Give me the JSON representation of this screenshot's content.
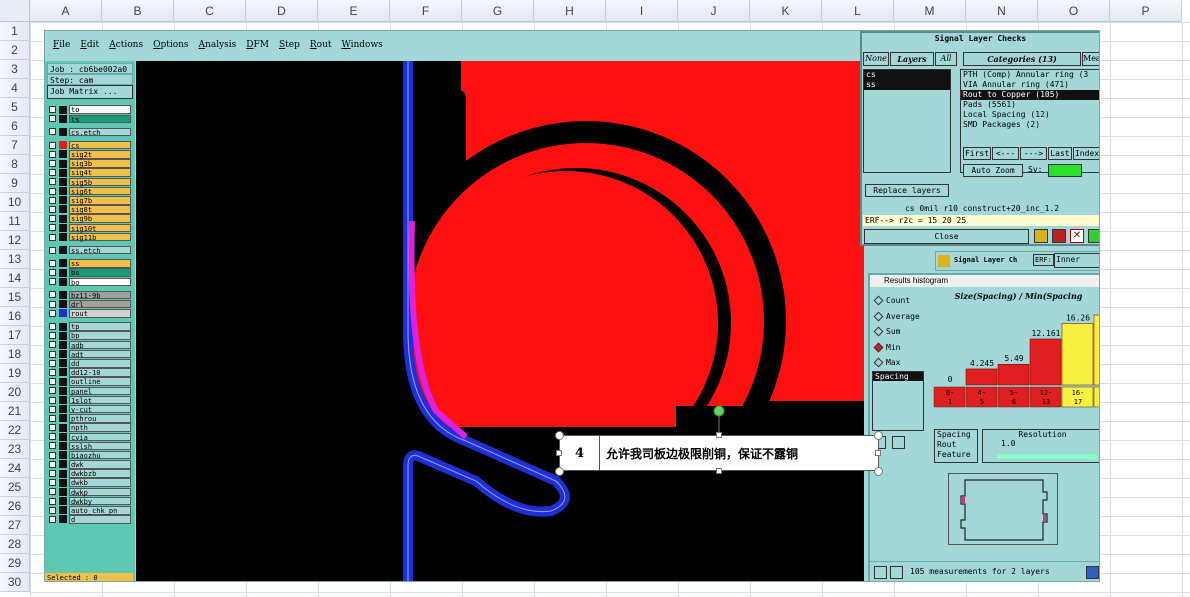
{
  "excel": {
    "columns": [
      "A",
      "B",
      "C",
      "D",
      "E",
      "F",
      "G",
      "H",
      "I",
      "J",
      "K",
      "L",
      "M",
      "N",
      "O",
      "P"
    ],
    "rows": [
      "1",
      "2",
      "3",
      "4",
      "5",
      "6",
      "7",
      "8",
      "9",
      "10",
      "11",
      "12",
      "13",
      "14",
      "15",
      "16",
      "17",
      "18",
      "19",
      "20",
      "21",
      "22",
      "23",
      "24",
      "25",
      "26",
      "27",
      "28",
      "29",
      "30"
    ]
  },
  "menu": [
    "File",
    "Edit",
    "Actions",
    "Options",
    "Analysis",
    "DFM",
    "Step",
    "Rout",
    "Windows"
  ],
  "left_panel": {
    "job": "Job : cb6be002a0",
    "step": "Step: cam",
    "job_matrix": "Job Matrix ...",
    "selected": "Selected : 0",
    "layers": [
      {
        "name": "to",
        "color": "#ffffff",
        "swatch": "#111111"
      },
      {
        "name": "ts",
        "color": "#1a9a7a",
        "swatch": "#111111"
      },
      {
        "gap": true
      },
      {
        "name": "cs.etch",
        "color": "#a4d7d8",
        "swatch": "#111111"
      },
      {
        "gap": true
      },
      {
        "name": "cs",
        "color": "#f0c04a",
        "swatch": "#e02020"
      },
      {
        "name": "sig2t",
        "color": "#f0c04a",
        "swatch": "#111111"
      },
      {
        "name": "sig3b",
        "color": "#f0c04a",
        "swatch": "#111111"
      },
      {
        "name": "sig4t",
        "color": "#f0c04a",
        "swatch": "#111111"
      },
      {
        "name": "sig5b",
        "color": "#f0c04a",
        "swatch": "#111111"
      },
      {
        "name": "sig6t",
        "color": "#f0c04a",
        "swatch": "#111111"
      },
      {
        "name": "sig7b",
        "color": "#f0c04a",
        "swatch": "#111111"
      },
      {
        "name": "sig8t",
        "color": "#f0c04a",
        "swatch": "#111111"
      },
      {
        "name": "sig9b",
        "color": "#f0c04a",
        "swatch": "#111111"
      },
      {
        "name": "sig10t",
        "color": "#f0c04a",
        "swatch": "#111111"
      },
      {
        "name": "sig11b",
        "color": "#f0c04a",
        "swatch": "#111111"
      },
      {
        "gap": true
      },
      {
        "name": "ss.etch",
        "color": "#a4d7d8",
        "swatch": "#111111"
      },
      {
        "gap": true
      },
      {
        "name": "ss",
        "color": "#f0c04a",
        "swatch": "#111111"
      },
      {
        "name": "bs",
        "color": "#1a9a7a",
        "swatch": "#111111"
      },
      {
        "name": "bo",
        "color": "#ffffff",
        "swatch": "#111111"
      },
      {
        "gap": true
      },
      {
        "name": "bz11-9b",
        "color": "#a0a0a0",
        "swatch": "#111111"
      },
      {
        "name": "drl",
        "color": "#a0a0a0",
        "swatch": "#111111"
      },
      {
        "name": "rout",
        "color": "#d0d0d0",
        "swatch": "#2030d0"
      },
      {
        "gap": true
      },
      {
        "name": "tp",
        "color": "#a4d7d8",
        "swatch": "#111111"
      },
      {
        "name": "bp",
        "color": "#a4d7d8",
        "swatch": "#111111"
      },
      {
        "name": "adb",
        "color": "#a4d7d8",
        "swatch": "#111111"
      },
      {
        "name": "adt",
        "color": "#a4d7d8",
        "swatch": "#111111"
      },
      {
        "name": "dd",
        "color": "#a4d7d8",
        "swatch": "#111111"
      },
      {
        "name": "dd12-10",
        "color": "#a4d7d8",
        "swatch": "#111111"
      },
      {
        "name": "outline",
        "color": "#a4d7d8",
        "swatch": "#111111"
      },
      {
        "name": "panel",
        "color": "#a4d7d8",
        "swatch": "#111111"
      },
      {
        "name": "1slot",
        "color": "#a4d7d8",
        "swatch": "#111111"
      },
      {
        "name": "v-cut",
        "color": "#a4d7d8",
        "swatch": "#111111"
      },
      {
        "name": "pthrou",
        "color": "#a4d7d8",
        "swatch": "#111111"
      },
      {
        "name": "npth",
        "color": "#a4d7d8",
        "swatch": "#111111"
      },
      {
        "name": "cvia",
        "color": "#a4d7d8",
        "swatch": "#111111"
      },
      {
        "name": "sslsh",
        "color": "#a4d7d8",
        "swatch": "#111111"
      },
      {
        "name": "biaozhu",
        "color": "#a4d7d8",
        "swatch": "#111111"
      },
      {
        "name": "dwk",
        "color": "#a4d7d8",
        "swatch": "#111111"
      },
      {
        "name": "dwkbzb",
        "color": "#a4d7d8",
        "swatch": "#111111"
      },
      {
        "name": "dwkb",
        "color": "#a4d7d8",
        "swatch": "#111111"
      },
      {
        "name": "dwkp",
        "color": "#a4d7d8",
        "swatch": "#111111"
      },
      {
        "name": "dwkby",
        "color": "#a4d7d8",
        "swatch": "#111111"
      },
      {
        "name": "auto_chk_pn",
        "color": "#a4d7d8",
        "swatch": "#111111"
      },
      {
        "name": "d",
        "color": "#a4d7d8",
        "swatch": "#111111"
      }
    ]
  },
  "signal_checks": {
    "title": "Signal Layer Checks",
    "tab_none": "None",
    "tab_layers": "Layers",
    "tab_all": "All",
    "tab_categories": "Categories (13)",
    "tab_meas": "Meas",
    "layers": [
      "cs",
      "ss"
    ],
    "categories": [
      {
        "text": "PTH (Comp) Annular ring (3",
        "selected": false
      },
      {
        "text": "VIA Annular ring (471)",
        "selected": false
      },
      {
        "text": "Rout to Copper (105)",
        "selected": true
      },
      {
        "text": "Pads (5561)",
        "selected": false
      },
      {
        "text": "Local Spacing (12)",
        "selected": false
      },
      {
        "text": "SMD Packages (2)",
        "selected": false
      }
    ],
    "nav": [
      "First",
      "<---",
      "--->",
      "Last",
      "Index"
    ],
    "auto_zoom": "Auto Zoom",
    "sv": "Sv:",
    "replace_layers": "Replace layers",
    "status": "cs  0mil  r10  construct+20_inc_1.2",
    "erf": "ERF--> r2c = 15 20 25",
    "close": "Close"
  },
  "signal_tab": {
    "title": "Signal Layer Ch",
    "erf_label": "ERF:",
    "erf_value": "Inner"
  },
  "histogram": {
    "window_title": "Results histogram",
    "modes": [
      {
        "label": "Count",
        "on": false
      },
      {
        "label": "Average",
        "on": false
      },
      {
        "label": "Sum",
        "on": false
      },
      {
        "label": "Min",
        "on": true
      },
      {
        "label": "Max",
        "on": false
      }
    ],
    "chart_title": "Size(Spacing) / Min(Spacing",
    "bars": [
      {
        "label": "0",
        "range": "0-\n1",
        "value": 0,
        "color": "#e02020"
      },
      {
        "label": "4.245",
        "range": "4-\n5",
        "value": 4.245,
        "color": "#e02020"
      },
      {
        "label": "5.49",
        "range": "5-\n6",
        "value": 5.49,
        "color": "#e02020"
      },
      {
        "label": "12.161",
        "range": "12-\n13",
        "value": 12.161,
        "color": "#e02020"
      },
      {
        "label": "16.26",
        "range": "16-\n17",
        "value": 16.26,
        "color": "#f8f040"
      },
      {
        "label": "1",
        "range": "",
        "value": 18.5,
        "color": "#f8f040"
      }
    ],
    "list_items": [
      "Spacing"
    ],
    "size_list": [
      "Spacing",
      "Rout",
      "Feature"
    ],
    "resolution_label": "Resolution",
    "resolution_value": "1.0",
    "footer": "105 measurements for 2 layers"
  },
  "callout": {
    "number": "4",
    "text": "允许我司板边极限削铜，保证不露铜"
  }
}
